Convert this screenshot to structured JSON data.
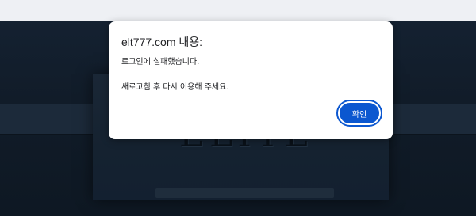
{
  "dialog": {
    "title": "elt777.com 내용:",
    "line1": "로그인에 실패했습니다.",
    "line2": "새로고침 후 다시 이용해 주세요.",
    "confirm_label": "확인"
  },
  "background": {
    "logo_text": "ELITE"
  },
  "colors": {
    "accent": "#0b57d0",
    "page_bg": "#0f1a26",
    "dialog_bg": "#ffffff",
    "browser_bar": "#eef0f4"
  }
}
